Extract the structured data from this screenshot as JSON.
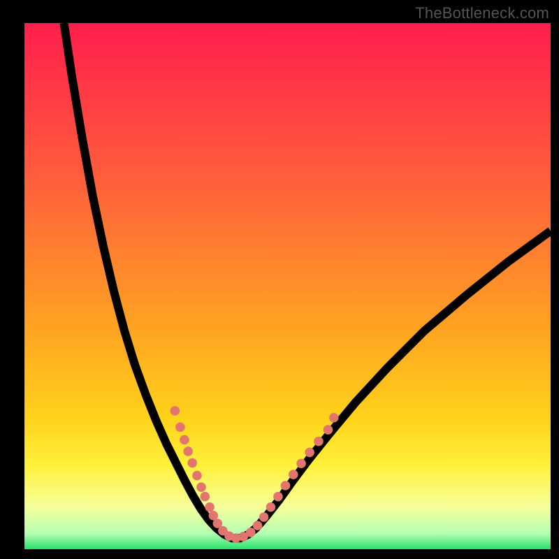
{
  "watermark": "TheBottleneck.com",
  "gradient_colors": {
    "c0": "#ff1e4c",
    "c1": "#ff5a3d",
    "c2": "#ffa322",
    "c3": "#ffd21a",
    "c4": "#fff03a",
    "c5": "#f6ff9a",
    "c6": "#b6ffb3",
    "c7": "#27e06b"
  },
  "chart_data": {
    "type": "line",
    "title": "",
    "xlabel": "",
    "ylabel": "",
    "xlim": [
      0,
      100
    ],
    "ylim": [
      0,
      100
    ],
    "note": "Bottleneck-style V-curve. x/y are percentages of the plot area (0,0 = top-left). No axis ticks visible.",
    "series": [
      {
        "name": "curve-left",
        "x": [
          7.5,
          9,
          11,
          13,
          15,
          17,
          19,
          21,
          23,
          25,
          27,
          29,
          30.5,
          32,
          33.5,
          35,
          36.5
        ],
        "y": [
          0,
          10,
          22,
          33,
          42.5,
          51,
          58.5,
          65,
          70.5,
          75.5,
          80,
          84,
          87,
          89.8,
          92.3,
          94.4,
          96
        ]
      },
      {
        "name": "curve-bottom",
        "x": [
          36.5,
          38,
          39.5,
          41,
          42.5,
          44
        ],
        "y": [
          96,
          97.2,
          97.9,
          97.9,
          97.2,
          96
        ]
      },
      {
        "name": "curve-right",
        "x": [
          44,
          46,
          48.5,
          51,
          54,
          58,
          63,
          69,
          76,
          84,
          92,
          100
        ],
        "y": [
          96,
          93.7,
          90.5,
          87,
          83,
          78,
          72,
          65.5,
          58.5,
          51.7,
          45.3,
          39.5
        ]
      }
    ],
    "markers": {
      "name": "dotted-segments",
      "color": "#e2766f",
      "radius_pct": 0.9,
      "points_xy": [
        [
          28.6,
          73.7
        ],
        [
          29.6,
          76.8
        ],
        [
          30.4,
          79.2
        ],
        [
          31.1,
          81.4
        ],
        [
          31.9,
          83.6
        ],
        [
          32.8,
          86.0
        ],
        [
          33.6,
          88.2
        ],
        [
          34.3,
          90.0
        ],
        [
          35.2,
          92.0
        ],
        [
          35.9,
          93.6
        ],
        [
          36.7,
          95.1
        ],
        [
          37.7,
          96.5
        ],
        [
          38.9,
          97.5
        ],
        [
          40.2,
          97.9
        ],
        [
          41.6,
          97.6
        ],
        [
          43.0,
          96.8
        ],
        [
          44.3,
          95.5
        ],
        [
          45.5,
          93.9
        ],
        [
          46.8,
          92.0
        ],
        [
          48.2,
          90.0
        ],
        [
          49.6,
          87.9
        ],
        [
          51.1,
          85.8
        ],
        [
          52.6,
          83.7
        ],
        [
          54.2,
          81.6
        ],
        [
          55.9,
          79.5
        ],
        [
          57.7,
          77.3
        ],
        [
          58.8,
          75.0
        ]
      ]
    }
  }
}
